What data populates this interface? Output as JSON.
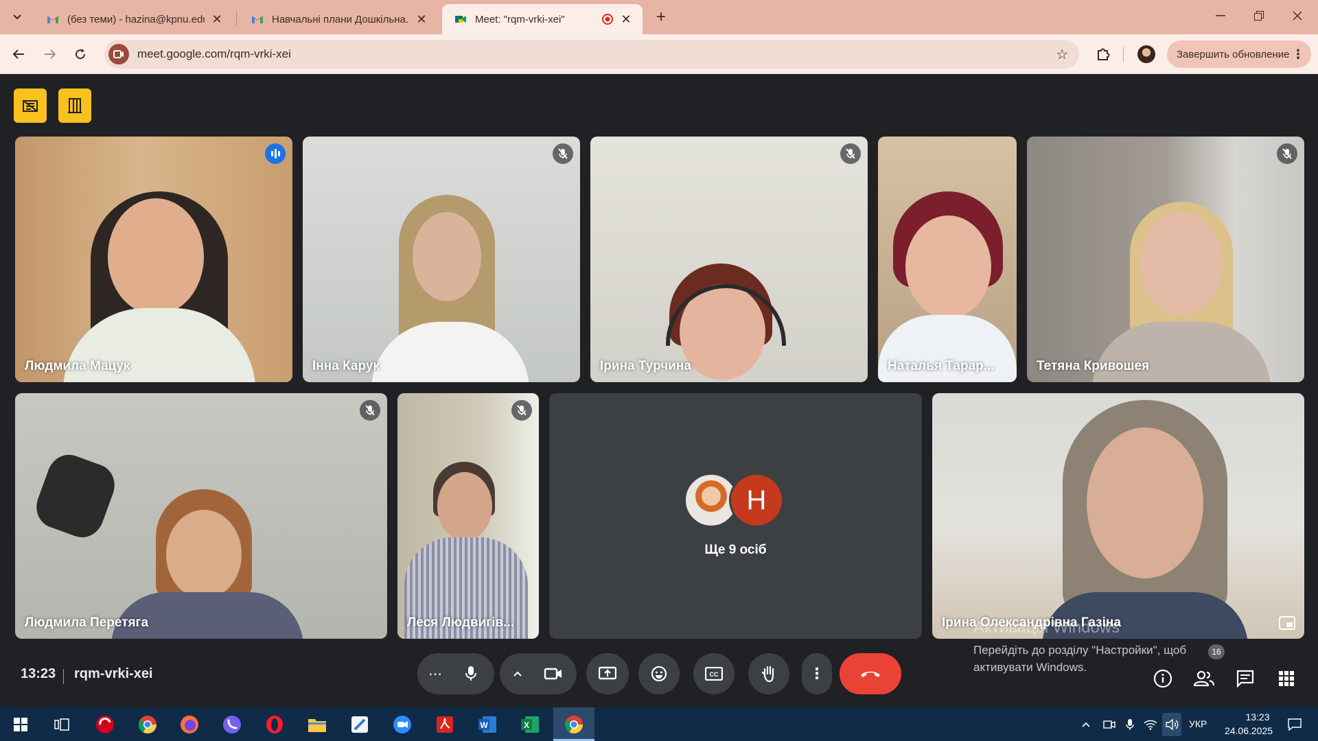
{
  "browser": {
    "tabs": [
      {
        "title": "(без теми) - hazina@kpnu.edu.ua",
        "icon": "gmail-icon"
      },
      {
        "title": "Навчальні плани Дошкільна. А",
        "icon": "gmail-icon"
      },
      {
        "title": "Meet: \"rqm-vrki-xei\"",
        "icon": "meet-icon",
        "active": true
      }
    ],
    "url": "meet.google.com/rqm-vrki-xei",
    "update_label": "Завершить обновление"
  },
  "meet": {
    "participants": [
      {
        "name": "Людмила Мацук",
        "speaking": true
      },
      {
        "name": "Інна Карук",
        "muted": true
      },
      {
        "name": "Ірина Турчина",
        "muted": true
      },
      {
        "name": "Наталья Тарар...",
        "muted": false
      },
      {
        "name": "Тетяна Кривошея",
        "muted": true
      },
      {
        "name": "Людмила Перетяга",
        "muted": true
      },
      {
        "name": "Леся Людвигів...",
        "muted": true
      },
      {
        "name": "Ірина Олександрівна Газіна",
        "self": true
      }
    ],
    "others": {
      "label": "Ще 9 осіб",
      "avatar_letter": "H"
    },
    "time": "13:23",
    "meeting_code": "rqm-vrki-xei",
    "people_count": "16"
  },
  "windows_activation": {
    "title": "Активація Windows",
    "text": "Перейдіть до розділу \"Настройки\", щоб активувати Windows."
  },
  "taskbar": {
    "language": "УКР",
    "time": "13:23",
    "date": "24.06.2025"
  },
  "colors": {
    "accent_end_call": "#ea4335",
    "meet_bg": "#202124",
    "browser_frame": "#e8b4a5"
  }
}
